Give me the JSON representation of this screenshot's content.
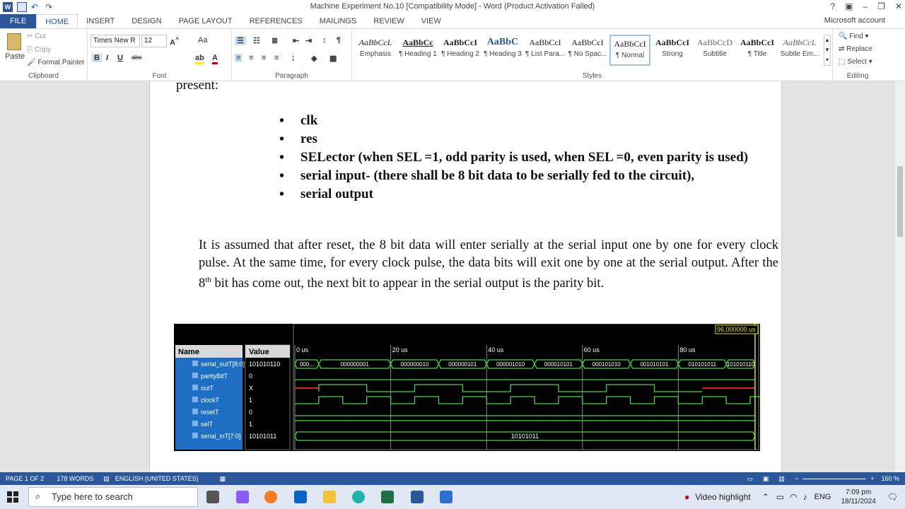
{
  "window": {
    "title": "Machine Experiment No.10 [Compatibility Mode] - Word (Product Activation Failed)",
    "account": "Microsoft account"
  },
  "tabs": [
    "FILE",
    "HOME",
    "INSERT",
    "DESIGN",
    "PAGE LAYOUT",
    "REFERENCES",
    "MAILINGS",
    "REVIEW",
    "VIEW"
  ],
  "clipboard": {
    "paste": "Paste",
    "cut": "Cut",
    "copy": "Copy",
    "format_painter": "Format Painter",
    "label": "Clipboard"
  },
  "font": {
    "name": "Times New R",
    "size": "12",
    "label": "Font"
  },
  "paragraph": {
    "label": "Paragraph"
  },
  "styles": {
    "label": "Styles",
    "items": [
      {
        "sample": "AaBbCcL",
        "name": "Emphasis"
      },
      {
        "sample": "AaBbCc",
        "name": "¶ Heading 1"
      },
      {
        "sample": "AaBbCcI",
        "name": "¶ Heading 2"
      },
      {
        "sample": "AaBbC",
        "name": "¶ Heading 3"
      },
      {
        "sample": "AaBbCcI",
        "name": "¶ List Para..."
      },
      {
        "sample": "AaBbCcI",
        "name": "¶ No Spac..."
      },
      {
        "sample": "AaBbCcI",
        "name": "¶ Normal"
      },
      {
        "sample": "AaBbCcI",
        "name": "Strong"
      },
      {
        "sample": "AaBbCcD",
        "name": "Subtitle"
      },
      {
        "sample": "AaBbCcI",
        "name": "¶ Title"
      },
      {
        "sample": "AaBbCcL",
        "name": "Subtle Em..."
      }
    ]
  },
  "editing": {
    "find": "Find",
    "replace": "Replace",
    "select": "Select",
    "label": "Editing"
  },
  "document": {
    "present": "present:",
    "bullets": [
      "clk",
      "res",
      "SELector (when SEL =1, odd parity is used, when SEL =0, even parity is used)",
      "serial input- (there shall be 8 bit data to be serially fed to the circuit),",
      "serial output"
    ],
    "paragraph_a": "It is assumed that after reset, the 8 bit data will enter serially at the serial input one by one for every clock pulse. At the same time, for every clock pulse, the data bits will exit one by one at the serial output. After the 8",
    "paragraph_sup": "th",
    "paragraph_b": " bit has come out, the next bit to appear in the serial output is the parity bit."
  },
  "waveform": {
    "time_cursor": "96.000000 us",
    "headers": {
      "name": "Name",
      "value": "Value"
    },
    "signals": [
      {
        "name": "serial_outT[8:0]",
        "value": "101010110"
      },
      {
        "name": "parityBitT",
        "value": "0"
      },
      {
        "name": "outT",
        "value": "X"
      },
      {
        "name": "clockT",
        "value": "1"
      },
      {
        "name": "resetT",
        "value": "0"
      },
      {
        "name": "selT",
        "value": "1"
      },
      {
        "name": "serial_inT[7:0]",
        "value": "10101011"
      }
    ],
    "time_labels": [
      "0 us",
      "20 us",
      "40 us",
      "60 us",
      "80 us"
    ],
    "bus_values": [
      "000...",
      "000000001",
      "000000010",
      "000000101",
      "000001010",
      "000010101",
      "000101010",
      "001010101",
      "010101011",
      "101010110"
    ],
    "serial_in_value": "10101011"
  },
  "status": {
    "page": "PAGE 1 OF 2",
    "words": "178 WORDS",
    "language": "ENGLISH (UNITED STATES)",
    "zoom": "160 %"
  },
  "taskbar": {
    "search_placeholder": "Type here to search",
    "highlight": "Video highlight",
    "lang": "ENG",
    "time": "7:09 pm",
    "date": "18/11/2024"
  }
}
